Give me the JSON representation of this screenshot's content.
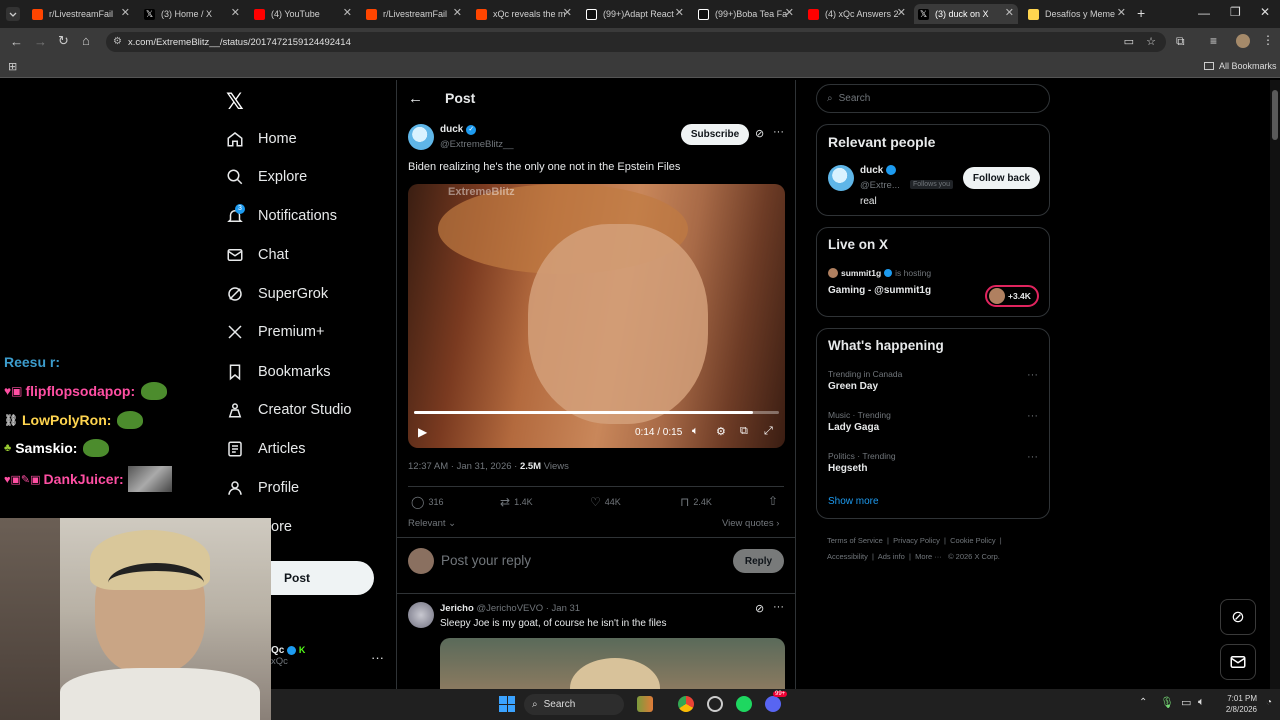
{
  "browser": {
    "tabs": [
      {
        "label": "r/LivestreamFail",
        "color": "#ff4500"
      },
      {
        "label": "(3) Home / X",
        "color": "#ffffff"
      },
      {
        "label": "(4) YouTube",
        "color": "#ff0000"
      },
      {
        "label": "r/LivestreamFail",
        "color": "#ff4500"
      },
      {
        "label": "xQc reveals the m",
        "color": "#ff4500"
      },
      {
        "label": "(99+)Adapt React",
        "color": "#ffffff"
      },
      {
        "label": "(99+)Boba Tea Fa",
        "color": "#ffffff"
      },
      {
        "label": "(4) xQc Answers 2",
        "color": "#ff0000"
      },
      {
        "label": "(3) duck on X",
        "color": "#ffffff"
      },
      {
        "label": "Desafíos y Meme",
        "color": "#ffd54f"
      }
    ],
    "url": "x.com/ExtremeBlitz__/status/2017472159124492414",
    "all_bookmarks": "All Bookmarks"
  },
  "nav": {
    "items": [
      {
        "label": "Home",
        "icon": "home-icon"
      },
      {
        "label": "Explore",
        "icon": "search-icon"
      },
      {
        "label": "Notifications",
        "icon": "bell-icon"
      },
      {
        "label": "Chat",
        "icon": "mail-icon"
      },
      {
        "label": "SuperGrok",
        "icon": "grok-icon"
      },
      {
        "label": "Premium+",
        "icon": "x-icon"
      },
      {
        "label": "Bookmarks",
        "icon": "bookmark-icon"
      },
      {
        "label": "Creator Studio",
        "icon": "creator-icon"
      },
      {
        "label": "Articles",
        "icon": "articles-icon"
      },
      {
        "label": "Profile",
        "icon": "profile-icon"
      }
    ],
    "more_partial": "ore",
    "post_button": "Post",
    "account_name_partial": "Qc",
    "account_handle_partial": "xQc",
    "notifications_badge": "3"
  },
  "post": {
    "header": "Post",
    "author_name": "duck",
    "author_handle": "@ExtremeBlitz__",
    "subscribe": "Subscribe",
    "text": "Biden realizing he's the only one not in the Epstein Files",
    "watermark": "ExtremeBlitz",
    "video_time": "0:14 / 0:15",
    "video_progress": 0.93,
    "timestamp": "12:37 AM · Jan 31, 2026 ·",
    "views_count": "2.5M",
    "views_label": "Views",
    "replies": "316",
    "reposts": "1.4K",
    "likes": "44K",
    "bookmarks": "2.4K",
    "relevant": "Relevant",
    "view_quotes": "View quotes",
    "reply_placeholder": "Post your reply",
    "reply_button": "Reply"
  },
  "reply": {
    "name": "Jericho",
    "handle": "@JerichoVEVO · Jan 31",
    "text": "Sleepy Joe is my goat, of course he isn't in the files"
  },
  "sidebar": {
    "search_placeholder": "Search",
    "relevant_title": "Relevant people",
    "person_name": "duck",
    "person_handle": "@Extre...",
    "follows_you": "Follows you",
    "follow_back": "Follow back",
    "person_bio": "real",
    "live_title": "Live on X",
    "live_host": "summit1g",
    "live_is_hosting": "is hosting",
    "live_show": "Gaming - @summit1g",
    "live_count": "+3.4K",
    "happening_title": "What's happening",
    "trends": [
      {
        "context": "Trending in Canada",
        "name": "Green Day"
      },
      {
        "context": "Music · Trending",
        "name": "Lady Gaga"
      },
      {
        "context": "Politics · Trending",
        "name": "Hegseth"
      }
    ],
    "show_more": "Show more",
    "footer_line1": [
      "Terms of Service",
      "Privacy Policy",
      "Cookie Policy"
    ],
    "footer_line2": [
      "Accessibility",
      "Ads info",
      "More ···",
      "© 2026 X Corp."
    ]
  },
  "chat_overlay": {
    "partial_top": "Reesu r:",
    "lines": [
      {
        "user": "flipflopsodapop:",
        "color": "#ff4fa3"
      },
      {
        "user": "LowPolyRon:",
        "color": "#ffd54f"
      },
      {
        "user": "Samskio:",
        "color": "#ffffff"
      },
      {
        "user": "DankJuicer:",
        "color": "#ff4fa3"
      }
    ]
  },
  "taskbar": {
    "search_label": "Search",
    "time": "7:01 PM",
    "date": "2/8/2026",
    "discord_badge": "99+"
  }
}
